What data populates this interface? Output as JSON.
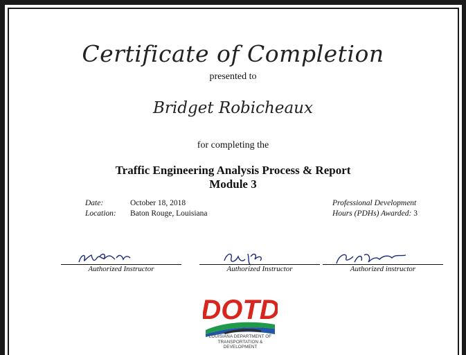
{
  "certificate": {
    "title": "Certificate of Completion",
    "presented_to": "presented to",
    "recipient": "Bridget Robicheaux",
    "for_completing": "for completing the",
    "course_line1": "Traffic Engineering Analysis Process & Report",
    "course_line2": "Module 3"
  },
  "details": {
    "date_label": "Date:",
    "date_value": "October 18, 2018",
    "location_label": "Location:",
    "location_value": "Baton Rouge, Louisiana",
    "pdh_label_line1": "Professional Development",
    "pdh_label_line2": "Hours (PDHs) Awarded:",
    "pdh_value": "3"
  },
  "signatures": [
    {
      "caption": "Authorized Instructor"
    },
    {
      "caption": "Authorized Instructor"
    },
    {
      "caption": "Authorized instructor"
    }
  ],
  "logo": {
    "text": "DOTD",
    "subtitle_line1": "LOUISIANA DEPARTMENT OF",
    "subtitle_line2": "TRANSPORTATION & DEVELOPMENT",
    "colors": {
      "red": "#d7261e",
      "green": "#1f9a48",
      "blue": "#2357a5",
      "road": "#2b2b2b"
    }
  }
}
